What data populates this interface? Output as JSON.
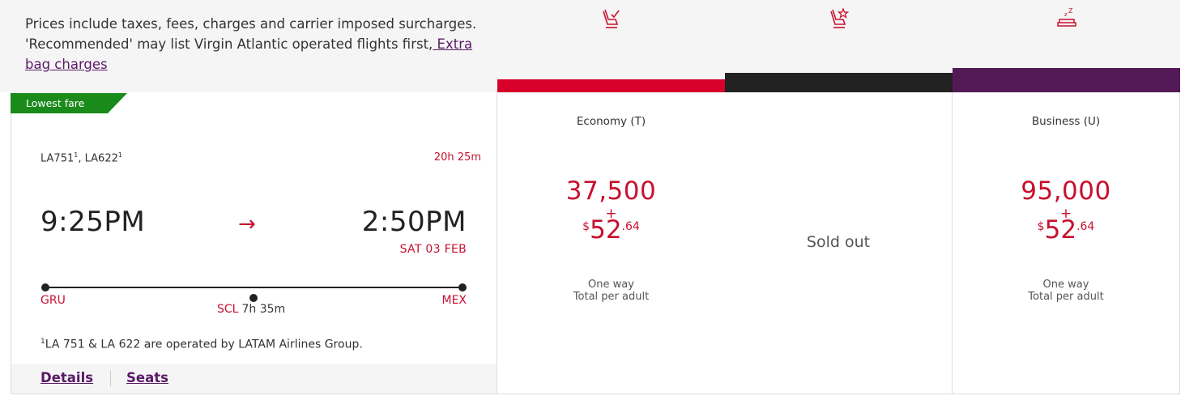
{
  "header": {
    "note_text": "Prices include taxes, fees, charges and carrier imposed surcharges. 'Recommended' may list Virgin Atlantic operated flights first,",
    "note_link": " Extra bag charges"
  },
  "cabins": [
    {
      "icon": "economy-seat-icon",
      "bar_color": "#d6002a",
      "name": "Economy (T)",
      "miles": "37,500",
      "plus": "+",
      "currency": "$",
      "cash_whole": "52",
      "cash_cents": ".64",
      "line1": "One way",
      "line2": "Total per adult",
      "status": ""
    },
    {
      "icon": "premium-seat-icon",
      "bar_color": "#222222",
      "name": "",
      "status": "Sold out"
    },
    {
      "icon": "upper-class-bed-icon",
      "bar_color": "#541a57",
      "name": "Business (U)",
      "miles": "95,000",
      "plus": "+",
      "currency": "$",
      "cash_whole": "52",
      "cash_cents": ".64",
      "line1": "One way",
      "line2": "Total per adult",
      "status": ""
    }
  ],
  "flight": {
    "badge": "Lowest fare",
    "badge_color": "#1a8a1a",
    "flight1": "LA751",
    "flight2": "LA622",
    "sup": "1",
    "separator": ", ",
    "duration": "20h 25m",
    "depart_time": "9:25PM",
    "arrow": "→",
    "arrive_time": "2:50PM",
    "arrive_date": "SAT 03 FEB",
    "origin": "GRU",
    "stop": "SCL",
    "layover": "7h  35m",
    "destination": "MEX",
    "footnote_sup": "1",
    "footnote": "LA 751 & LA 622 are operated by LATAM Airlines Group.",
    "details_link": "Details",
    "seats_link": "Seats"
  }
}
